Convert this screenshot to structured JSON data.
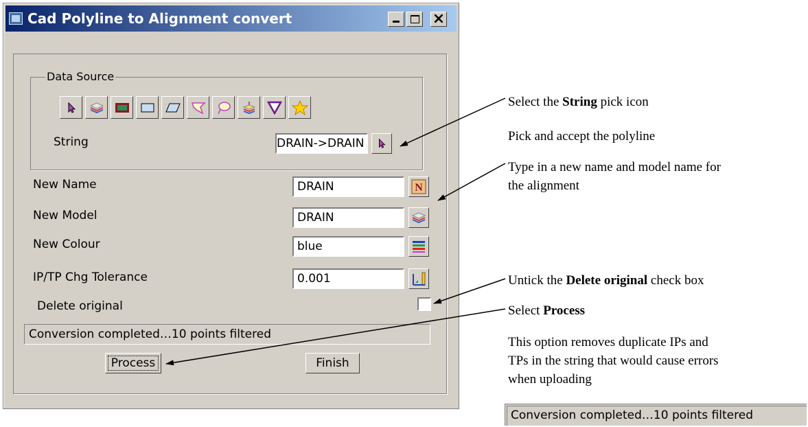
{
  "window": {
    "title": "Cad Polyline to Alignment convert",
    "controls": [
      "minimize",
      "maximize",
      "close"
    ],
    "close_glyph": "×"
  },
  "data_source": {
    "legend": "Data Source",
    "icons": [
      "string-pick-icon",
      "model-layers-icon",
      "view-icon",
      "rectangle-icon",
      "polygon-icon",
      "fence-icon",
      "lasso-icon",
      "filter-stack-icon",
      "funnel-icon",
      "favourite-star-icon"
    ],
    "string_label": "String",
    "string_value": "DRAIN->DRAIN"
  },
  "fields": {
    "new_name": {
      "label": "New Name",
      "value": "DRAIN"
    },
    "new_model": {
      "label": "New Model",
      "value": "DRAIN"
    },
    "new_colour": {
      "label": "New Colour",
      "value": "blue"
    },
    "tolerance": {
      "label": "IP/TP Chg Tolerance",
      "value": "0.001"
    }
  },
  "delete_original": {
    "label": "Delete original",
    "checked": false
  },
  "status_message": "Conversion completed…10 points filtered",
  "buttons": {
    "process": "Process",
    "finish": "Finish"
  },
  "annotations": {
    "select_string_prefix": "Select the ",
    "select_string_bold": "String",
    "select_string_suffix": " pick icon",
    "pick_accept": "Pick and accept the polyline",
    "type_name_line1": "Type in a new name and model name for",
    "type_name_line2": "the alignment",
    "untick_prefix": "Untick the ",
    "untick_bold": "Delete original",
    "untick_suffix": " check box",
    "select_process_prefix": "Select ",
    "select_process_bold": "Process",
    "option_line1": "This option removes duplicate IPs and",
    "option_line2": "TPs in the string that would cause errors",
    "option_line3": "when uploading"
  },
  "status_crop": "Conversion completed…10 points filtered",
  "colors": {
    "title_bar_start": "#0a246a",
    "dialog_bg": "#d4d0c8",
    "pick_arrow": "#c040c0"
  }
}
